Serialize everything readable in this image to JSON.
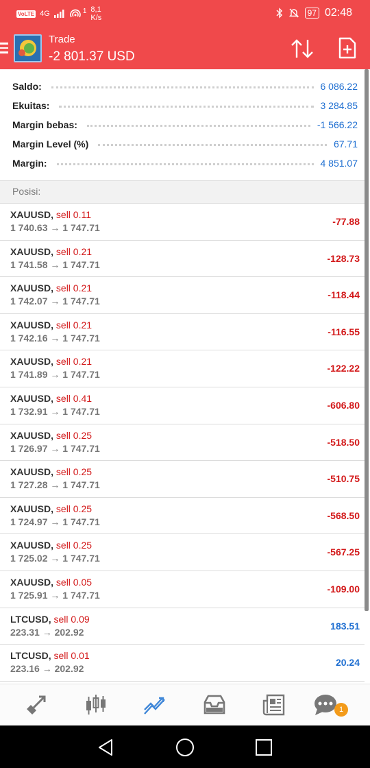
{
  "status_bar": {
    "volte": "VoLTE",
    "network": "4G",
    "signal_count": "1",
    "speed_value": "8,1",
    "speed_unit": "K/s",
    "battery": "97",
    "time": "02:48"
  },
  "header": {
    "title": "Trade",
    "balance_value": "-2 801.37 USD"
  },
  "summary": [
    {
      "label": "Saldo:",
      "value": "6 086.22"
    },
    {
      "label": "Ekuitas:",
      "value": "3 284.85"
    },
    {
      "label": "Margin bebas:",
      "value": "-1 566.22"
    },
    {
      "label": "Margin Level (%)",
      "value": "67.71"
    },
    {
      "label": "Margin:",
      "value": "4 851.07"
    }
  ],
  "positions_header": "Posisi:",
  "positions": [
    {
      "symbol": "XAUUSD,",
      "side": "sell 0.11",
      "prices": "1 740.63 → 1 747.71",
      "pl": "-77.88"
    },
    {
      "symbol": "XAUUSD,",
      "side": "sell 0.21",
      "prices": "1 741.58 → 1 747.71",
      "pl": "-128.73"
    },
    {
      "symbol": "XAUUSD,",
      "side": "sell 0.21",
      "prices": "1 742.07 → 1 747.71",
      "pl": "-118.44"
    },
    {
      "symbol": "XAUUSD,",
      "side": "sell 0.21",
      "prices": "1 742.16 → 1 747.71",
      "pl": "-116.55"
    },
    {
      "symbol": "XAUUSD,",
      "side": "sell 0.21",
      "prices": "1 741.89 → 1 747.71",
      "pl": "-122.22"
    },
    {
      "symbol": "XAUUSD,",
      "side": "sell 0.41",
      "prices": "1 732.91 → 1 747.71",
      "pl": "-606.80"
    },
    {
      "symbol": "XAUUSD,",
      "side": "sell 0.25",
      "prices": "1 726.97 → 1 747.71",
      "pl": "-518.50"
    },
    {
      "symbol": "XAUUSD,",
      "side": "sell 0.25",
      "prices": "1 727.28 → 1 747.71",
      "pl": "-510.75"
    },
    {
      "symbol": "XAUUSD,",
      "side": "sell 0.25",
      "prices": "1 724.97 → 1 747.71",
      "pl": "-568.50"
    },
    {
      "symbol": "XAUUSD,",
      "side": "sell 0.25",
      "prices": "1 725.02 → 1 747.71",
      "pl": "-567.25"
    },
    {
      "symbol": "XAUUSD,",
      "side": "sell 0.05",
      "prices": "1 725.91 → 1 747.71",
      "pl": "-109.00"
    },
    {
      "symbol": "LTCUSD,",
      "side": "sell 0.09",
      "prices": "223.31 → 202.92",
      "pl": "183.51"
    },
    {
      "symbol": "LTCUSD,",
      "side": "sell 0.01",
      "prices": "223.16 → 202.92",
      "pl": "20.24"
    },
    {
      "symbol": "",
      "side": "",
      "prices": "",
      "pl": ""
    }
  ],
  "tabs": [
    {
      "name": "quotes-icon"
    },
    {
      "name": "chart-icon"
    },
    {
      "name": "trade-icon",
      "active": true
    },
    {
      "name": "history-icon"
    },
    {
      "name": "news-icon"
    },
    {
      "name": "messages-icon",
      "badge": "1"
    }
  ],
  "colors": {
    "header_red": "#f0494b",
    "negative": "#d3191a",
    "positive": "#1f6fd1",
    "active_tab": "#3f87d8",
    "badge": "#f39b1a"
  }
}
